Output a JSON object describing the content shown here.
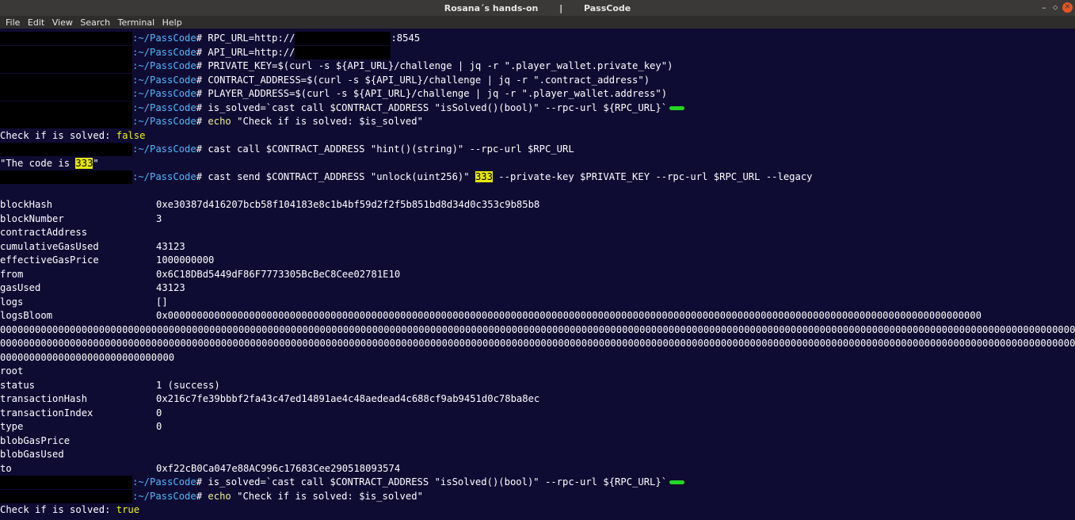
{
  "window": {
    "title": "Rosana´s hands-on       |       PassCode",
    "controls": {
      "minimize": "–",
      "maximize": "⬦",
      "close": "✕"
    }
  },
  "menu": [
    "File",
    "Edit",
    "View",
    "Search",
    "Terminal",
    "Help"
  ],
  "prompt": {
    "path": ":~/PassCode",
    "suffix": "# "
  },
  "commands": {
    "c1a": "RPC_URL=http://",
    "c1b": ":8545",
    "c2": "API_URL=http://",
    "c3": "PRIVATE_KEY=$(curl -s ${API_URL}/challenge | jq -r \".player_wallet.private_key\")",
    "c4": "CONTRACT_ADDRESS=$(curl -s ${API_URL}/challenge | jq -r \".contract_address\")",
    "c5": "PLAYER_ADDRESS=$(curl -s ${API_URL}/challenge | jq -r \".player_wallet.address\")",
    "c6": "is_solved=`cast call $CONTRACT_ADDRESS \"isSolved()(bool)\" --rpc-url ${RPC_URL}`",
    "c7kw": "echo",
    "c7": " \"Check if is solved: $is_solved\"",
    "c8": "cast call $CONTRACT_ADDRESS \"hint()(string)\" --rpc-url $RPC_URL",
    "c9a": "cast send $CONTRACT_ADDRESS \"unlock(uint256)\" ",
    "c9num": "333",
    "c9b": " --private-key $PRIVATE_KEY --rpc-url $RPC_URL --legacy"
  },
  "outputs": {
    "solved_label": "Check if is solved: ",
    "solved_false": "false",
    "solved_true": "true",
    "hint_a": "\"The code is ",
    "hint_num": "333",
    "hint_b": "\""
  },
  "receipt": {
    "blockHash": "0xe30387d416207bcb58f104183e8c1b4bf59d2f2f5b851bd8d34d0c353c9b85b8",
    "blockNumber": "3",
    "contractAddress": "",
    "cumulativeGasUsed": "43123",
    "effectiveGasPrice": "1000000000",
    "from": "0x6C18DBd5449dF86F7773305BcBeC8Cee02781E10",
    "gasUsed": "43123",
    "logs": "[]",
    "logsBloom1": "0x00000000000000000000000000000000000000000000000000000000000000000000000000000000000000000000000000000000000000000000000000000000000000000000",
    "logsBloom2": "0000000000000000000000000000000000000000000000000000000000000000000000000000000000000000000000000000000000000000000000000000000000000000000000000000000000000000000000000000000000000000000000",
    "logsBloom3": "0000000000000000000000000000000000000000000000000000000000000000000000000000000000000000000000000000000000000000000000000000000000000000000000000000000000000000000000000000000000000000000000",
    "logsBloom4": "000000000000000000000000000000",
    "root": "",
    "status": "1 (success)",
    "transactionHash": "0x216c7fe39bbbf2fa43c47ed14891ae4c48aedead4c688cf9ab9451d0c78ba8ec",
    "transactionIndex": "0",
    "type": "0",
    "blobGasPrice": "",
    "blobGasUsed": "",
    "to": "0xf22cB0Ca047e88AC996c17683Cee290518093574"
  },
  "receipt_keys": {
    "blockHash": "blockHash",
    "blockNumber": "blockNumber",
    "contractAddress": "contractAddress",
    "cumulativeGasUsed": "cumulativeGasUsed",
    "effectiveGasPrice": "effectiveGasPrice",
    "from": "from",
    "gasUsed": "gasUsed",
    "logs": "logs",
    "logsBloom": "logsBloom",
    "root": "root",
    "status": "status",
    "transactionHash": "transactionHash",
    "transactionIndex": "transactionIndex",
    "type": "type",
    "blobGasPrice": "blobGasPrice",
    "blobGasUsed": "blobGasUsed",
    "to": "to"
  },
  "colors": {
    "background": "#0f0c33",
    "path": "#4fb8ff",
    "highlight": "#e8e800",
    "cursor_green": "#22d81f"
  }
}
